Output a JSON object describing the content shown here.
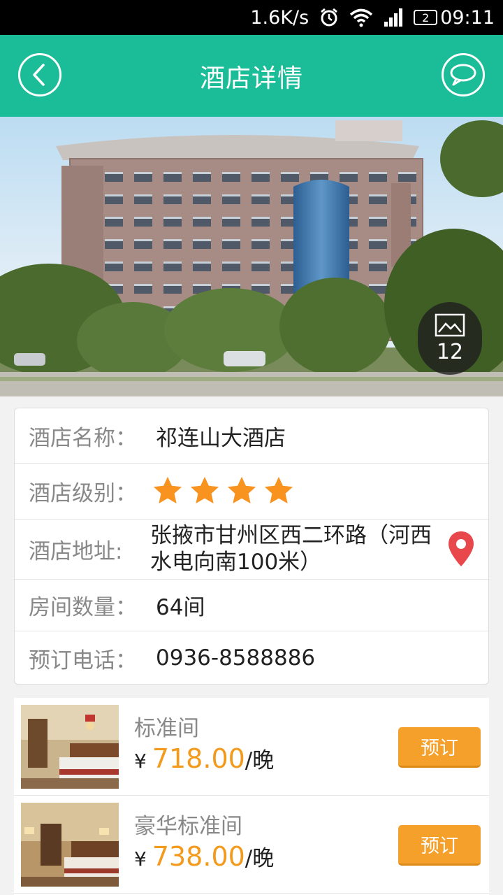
{
  "status_bar": {
    "speed": "1.6K/s",
    "sim": "2",
    "time": "09:11"
  },
  "header": {
    "title": "酒店详情"
  },
  "hero": {
    "photo_count": "12"
  },
  "info": {
    "name_label": "酒店名称：",
    "name_value": "祁连山大酒店",
    "level_label": "酒店级别：",
    "level_stars": 4,
    "address_label": "酒店地址:",
    "address_value": "张掖市甘州区西二环路（河西水电向南100米）",
    "rooms_label": "房间数量：",
    "rooms_value": "64间",
    "phone_label": "预订电话：",
    "phone_value": "0936-8588886"
  },
  "rooms": [
    {
      "name": "标准间",
      "currency": "¥",
      "price": "718.00",
      "unit": "/晚",
      "book_label": "预订"
    },
    {
      "name": "豪华标准间",
      "currency": "¥",
      "price": "738.00",
      "unit": "/晚",
      "book_label": "预订"
    }
  ],
  "colors": {
    "accent": "#1bbd98",
    "price": "#f39a1d",
    "button": "#f5a02a",
    "star": "#f7931e",
    "pin": "#e8474b"
  },
  "icons": {
    "back": "chevron-left-icon",
    "chat": "chat-bubble-icon",
    "gallery": "image-icon",
    "location": "map-pin-icon"
  }
}
